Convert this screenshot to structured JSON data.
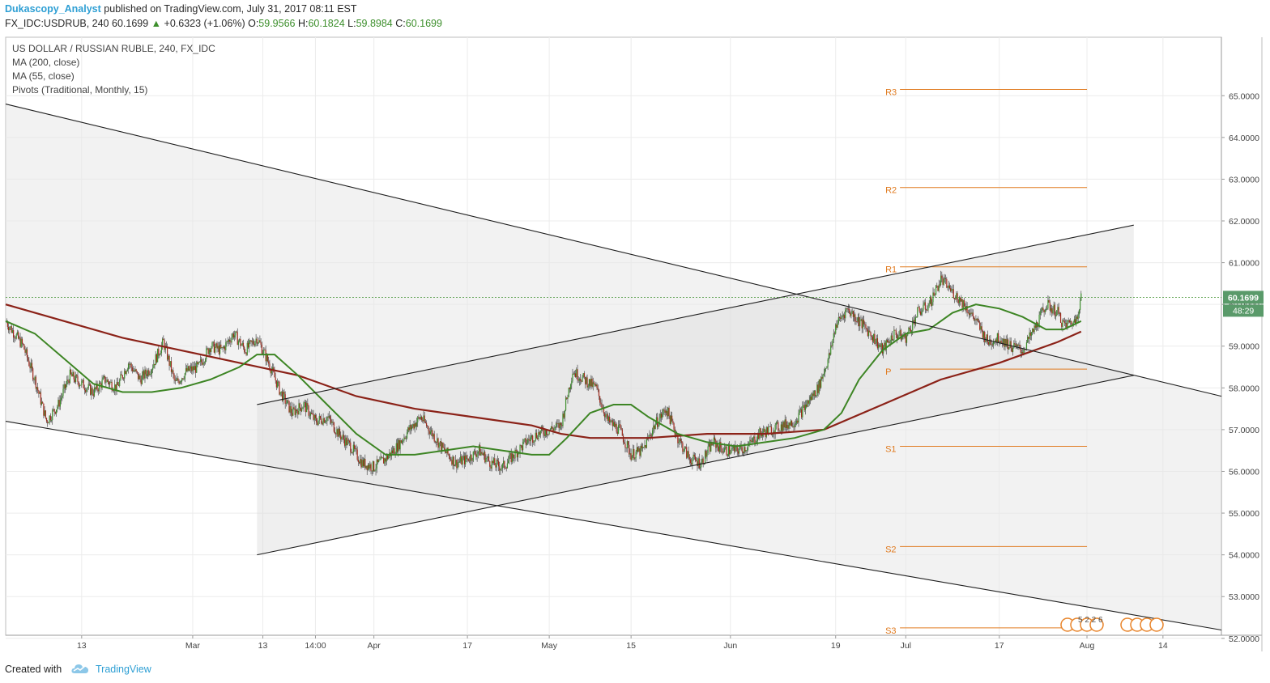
{
  "header": {
    "author": "Dukascopy_Analyst",
    "published": "published on TradingView.com, July 31, 2017 08:11 EST",
    "symbol_line": "FX_IDC:USDRUB, 240",
    "last": "60.1699",
    "arrow": "▲",
    "change": "+0.6323 (+1.06%)",
    "open_label": "O:",
    "open": "59.9566",
    "high_label": "H:",
    "high": "60.1824",
    "low_label": "L:",
    "low": "59.8984",
    "close_label": "C:",
    "close": "60.1699"
  },
  "legend": [
    "US DOLLAR / RUSSIAN RUBLE, 240, FX_IDC",
    "MA (200, close)",
    "MA (55, close)",
    "Pivots (Traditional, Monthly, 15)"
  ],
  "footer": {
    "created_with": "Created with",
    "brand": "TradingView"
  },
  "colors": {
    "up_candle": "#3d8f2c",
    "down_candle": "#a02a1c",
    "ma200": "#8b2218",
    "ma55": "#3d8524",
    "pivot": "#e07a1f",
    "channel": "#1e1e1e",
    "fill": "#e7e7e7",
    "price_label_bg": "#5a9a6a",
    "author": "#2e9fd4"
  },
  "icons": {
    "brand_logo": "tradingview-cloud-icon",
    "calendar_events": "us-flag-event-icon"
  },
  "chart_data": {
    "type": "candlestick",
    "ylim": [
      51.6,
      65.8
    ],
    "grid": true,
    "y_ticks": [
      "52.0000",
      "53.0000",
      "54.0000",
      "55.0000",
      "56.0000",
      "57.0000",
      "58.0000",
      "59.0000",
      "60.0000",
      "61.0000",
      "62.0000",
      "63.0000",
      "64.0000",
      "65.0000"
    ],
    "x_ticks": [
      {
        "label": "13",
        "day": 13
      },
      {
        "label": "Mar",
        "day": 32
      },
      {
        "label": "13",
        "day": 44
      },
      {
        "label": "14:00",
        "day": 53
      },
      {
        "label": "Apr",
        "day": 63
      },
      {
        "label": "17",
        "day": 79
      },
      {
        "label": "May",
        "day": 93
      },
      {
        "label": "15",
        "day": 107
      },
      {
        "label": "Jun",
        "day": 124
      },
      {
        "label": "19",
        "day": 142
      },
      {
        "label": "Jul",
        "day": 154
      },
      {
        "label": "17",
        "day": 170
      },
      {
        "label": "Aug",
        "day": 185
      },
      {
        "label": "14",
        "day": 198
      }
    ],
    "x_axis_note": "day = days since 2017-02-01",
    "last_price_label": "60.1699",
    "countdown_label": "48:29",
    "last_price": 60.1699,
    "close_path": [
      [
        0,
        59.6
      ],
      [
        3,
        59.0
      ],
      [
        5,
        58.2
      ],
      [
        7,
        57.2
      ],
      [
        9,
        57.6
      ],
      [
        11,
        58.3
      ],
      [
        13,
        58.1
      ],
      [
        15,
        57.9
      ],
      [
        17,
        58.2
      ],
      [
        19,
        58.0
      ],
      [
        21,
        58.6
      ],
      [
        23,
        58.2
      ],
      [
        25,
        58.5
      ],
      [
        27,
        59.1
      ],
      [
        29,
        58.1
      ],
      [
        31,
        58.4
      ],
      [
        33,
        58.5
      ],
      [
        35,
        59.0
      ],
      [
        37,
        58.9
      ],
      [
        39,
        59.3
      ],
      [
        41,
        58.9
      ],
      [
        43,
        59.2
      ],
      [
        45,
        58.6
      ],
      [
        47,
        57.9
      ],
      [
        49,
        57.4
      ],
      [
        51,
        57.6
      ],
      [
        53,
        57.2
      ],
      [
        55,
        57.3
      ],
      [
        57,
        56.9
      ],
      [
        59,
        56.6
      ],
      [
        61,
        56.2
      ],
      [
        63,
        56.1
      ],
      [
        65,
        56.3
      ],
      [
        67,
        56.6
      ],
      [
        69,
        57.0
      ],
      [
        71,
        57.3
      ],
      [
        73,
        56.9
      ],
      [
        75,
        56.5
      ],
      [
        77,
        56.2
      ],
      [
        79,
        56.3
      ],
      [
        81,
        56.5
      ],
      [
        83,
        56.2
      ],
      [
        85,
        56.1
      ],
      [
        87,
        56.4
      ],
      [
        89,
        56.7
      ],
      [
        91,
        56.9
      ],
      [
        93,
        57.0
      ],
      [
        95,
        57.1
      ],
      [
        97,
        58.4
      ],
      [
        99,
        58.2
      ],
      [
        101,
        58.0
      ],
      [
        103,
        57.2
      ],
      [
        105,
        57.0
      ],
      [
        107,
        56.4
      ],
      [
        109,
        56.5
      ],
      [
        111,
        57.1
      ],
      [
        113,
        57.5
      ],
      [
        115,
        56.8
      ],
      [
        117,
        56.3
      ],
      [
        119,
        56.2
      ],
      [
        121,
        56.7
      ],
      [
        123,
        56.5
      ],
      [
        125,
        56.5
      ],
      [
        127,
        56.6
      ],
      [
        129,
        56.9
      ],
      [
        131,
        57.0
      ],
      [
        133,
        57.1
      ],
      [
        135,
        57.2
      ],
      [
        137,
        57.6
      ],
      [
        139,
        58.0
      ],
      [
        141,
        58.8
      ],
      [
        142,
        59.5
      ],
      [
        144,
        59.9
      ],
      [
        146,
        59.6
      ],
      [
        148,
        59.3
      ],
      [
        150,
        58.9
      ],
      [
        152,
        59.3
      ],
      [
        154,
        59.2
      ],
      [
        156,
        59.8
      ],
      [
        158,
        60.0
      ],
      [
        160,
        60.6
      ],
      [
        162,
        60.3
      ],
      [
        164,
        60.0
      ],
      [
        166,
        59.6
      ],
      [
        168,
        59.1
      ],
      [
        170,
        59.2
      ],
      [
        172,
        59.0
      ],
      [
        174,
        58.9
      ],
      [
        176,
        59.4
      ],
      [
        178,
        60.0
      ],
      [
        180,
        59.8
      ],
      [
        181,
        59.5
      ],
      [
        183,
        59.6
      ],
      [
        184,
        60.17
      ]
    ],
    "ma55_path": [
      [
        0,
        59.6
      ],
      [
        5,
        59.3
      ],
      [
        10,
        58.7
      ],
      [
        15,
        58.1
      ],
      [
        20,
        57.9
      ],
      [
        25,
        57.9
      ],
      [
        30,
        58.0
      ],
      [
        35,
        58.2
      ],
      [
        40,
        58.5
      ],
      [
        43,
        58.8
      ],
      [
        46,
        58.8
      ],
      [
        50,
        58.3
      ],
      [
        55,
        57.6
      ],
      [
        60,
        56.9
      ],
      [
        65,
        56.4
      ],
      [
        70,
        56.4
      ],
      [
        75,
        56.5
      ],
      [
        80,
        56.6
      ],
      [
        85,
        56.5
      ],
      [
        90,
        56.4
      ],
      [
        93,
        56.4
      ],
      [
        96,
        56.8
      ],
      [
        100,
        57.4
      ],
      [
        104,
        57.6
      ],
      [
        107,
        57.6
      ],
      [
        110,
        57.3
      ],
      [
        115,
        56.9
      ],
      [
        120,
        56.7
      ],
      [
        125,
        56.6
      ],
      [
        130,
        56.7
      ],
      [
        135,
        56.8
      ],
      [
        140,
        57.0
      ],
      [
        143,
        57.4
      ],
      [
        146,
        58.2
      ],
      [
        150,
        58.9
      ],
      [
        154,
        59.3
      ],
      [
        158,
        59.4
      ],
      [
        162,
        59.8
      ],
      [
        166,
        60.0
      ],
      [
        170,
        59.9
      ],
      [
        174,
        59.7
      ],
      [
        178,
        59.4
      ],
      [
        181,
        59.4
      ],
      [
        184,
        59.6
      ]
    ],
    "ma200_path": [
      [
        0,
        60.0
      ],
      [
        10,
        59.6
      ],
      [
        20,
        59.2
      ],
      [
        30,
        58.9
      ],
      [
        40,
        58.6
      ],
      [
        50,
        58.3
      ],
      [
        60,
        57.8
      ],
      [
        70,
        57.5
      ],
      [
        80,
        57.3
      ],
      [
        90,
        57.1
      ],
      [
        95,
        56.9
      ],
      [
        100,
        56.8
      ],
      [
        110,
        56.8
      ],
      [
        120,
        56.9
      ],
      [
        130,
        56.9
      ],
      [
        140,
        57.0
      ],
      [
        150,
        57.6
      ],
      [
        160,
        58.2
      ],
      [
        170,
        58.6
      ],
      [
        180,
        59.1
      ],
      [
        184,
        59.35
      ]
    ],
    "pivots": [
      {
        "label": "R3",
        "value": 65.15
      },
      {
        "label": "R2",
        "value": 62.8
      },
      {
        "label": "R1",
        "value": 60.9
      },
      {
        "label": "P",
        "value": 58.45
      },
      {
        "label": "S1",
        "value": 56.6
      },
      {
        "label": "S2",
        "value": 54.2
      },
      {
        "label": "S3",
        "value": 52.25
      }
    ],
    "pivot_x_range": [
      153,
      185
    ],
    "trend_lines": [
      {
        "name": "outer-upper",
        "from": [
          0,
          64.8
        ],
        "to": [
          208,
          57.8
        ]
      },
      {
        "name": "outer-lower",
        "from": [
          0,
          57.2
        ],
        "to": [
          208,
          52.2
        ]
      },
      {
        "name": "inner-upper",
        "from": [
          43,
          57.6
        ],
        "to": [
          193,
          61.9
        ]
      },
      {
        "name": "inner-lower",
        "from": [
          43,
          54.0
        ],
        "to": [
          193,
          58.3
        ]
      }
    ],
    "events_label": "5 2 2 6"
  }
}
